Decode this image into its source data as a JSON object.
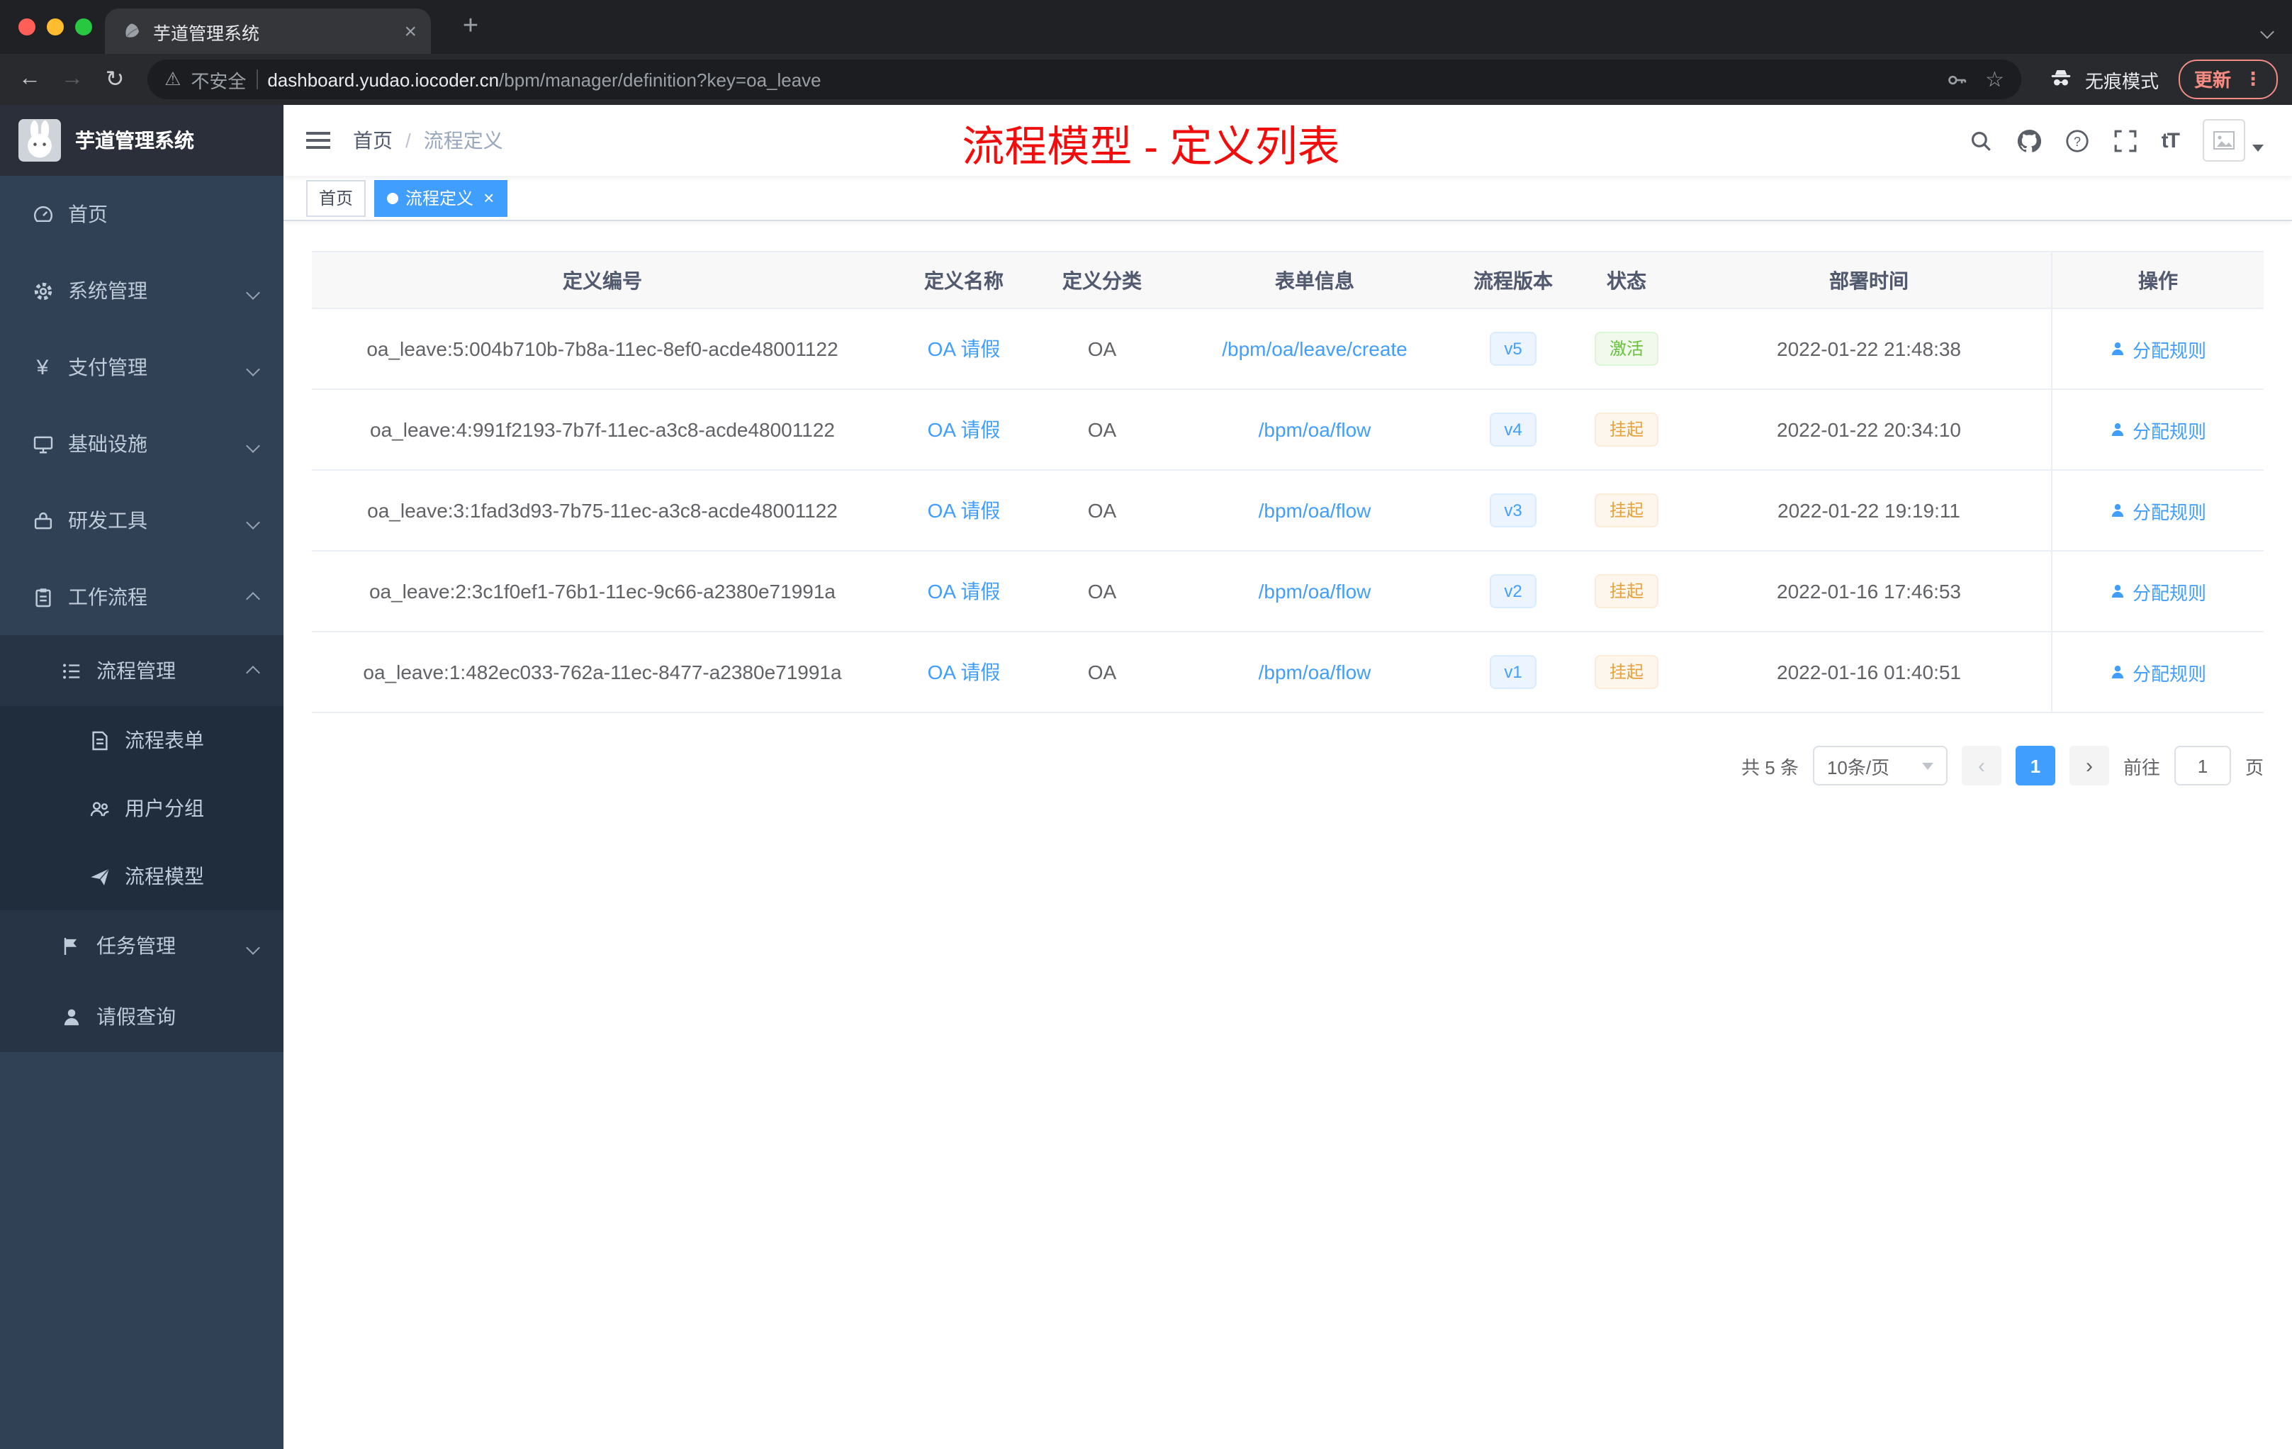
{
  "browser": {
    "tab": {
      "title": "芋道管理系统",
      "close": "×",
      "new_tab": "+"
    },
    "security_label": "不安全",
    "url_host": "dashboard.yudao.iocoder.cn",
    "url_path": "/bpm/manager/definition?key=oa_leave",
    "incognito_label": "无痕模式",
    "update_label": "更新",
    "menu_dots": "⋮"
  },
  "sidebar": {
    "logo_title": "芋道管理系统",
    "items": [
      {
        "label": "首页",
        "icon": "dashboard-icon",
        "level": 1
      },
      {
        "label": "系统管理",
        "icon": "gear-icon",
        "level": 1,
        "chevron": "down"
      },
      {
        "label": "支付管理",
        "icon": "yen-icon",
        "level": 1,
        "chevron": "down"
      },
      {
        "label": "基础设施",
        "icon": "infrastructure-icon",
        "level": 1,
        "chevron": "down"
      },
      {
        "label": "研发工具",
        "icon": "tools-icon",
        "level": 1,
        "chevron": "down"
      },
      {
        "label": "工作流程",
        "icon": "workflow-icon",
        "level": 1,
        "chevron": "up"
      },
      {
        "label": "流程管理",
        "icon": "process-list-icon",
        "level": 2,
        "chevron": "up"
      },
      {
        "label": "流程表单",
        "icon": "form-icon",
        "level": 3
      },
      {
        "label": "用户分组",
        "icon": "user-group-icon",
        "level": 3
      },
      {
        "label": "流程模型",
        "icon": "paper-plane-icon",
        "level": 3
      },
      {
        "label": "任务管理",
        "icon": "task-flag-icon",
        "level": 2,
        "chevron": "down"
      },
      {
        "label": "请假查询",
        "icon": "person-icon",
        "level": 2
      }
    ]
  },
  "header": {
    "breadcrumb_first": "首页",
    "breadcrumb_sep": "/",
    "breadcrumb_last": "流程定义",
    "annotation": "流程模型 - 定义列表",
    "icons": [
      "search-icon",
      "github-icon",
      "help-icon",
      "fullscreen-icon",
      "font-size-icon",
      "avatar"
    ]
  },
  "tags": [
    {
      "label": "首页",
      "active": false
    },
    {
      "label": "流程定义",
      "active": true,
      "close": "×"
    }
  ],
  "table": {
    "columns": [
      "定义编号",
      "定义名称",
      "定义分类",
      "表单信息",
      "流程版本",
      "状态",
      "部署时间",
      "操作"
    ],
    "rows": [
      {
        "id": "oa_leave:5:004b710b-7b8a-11ec-8ef0-acde48001122",
        "name": "OA 请假",
        "category": "OA",
        "form": "/bpm/oa/leave/create",
        "version": "v5",
        "status": "激活",
        "time": "2022-01-22 21:48:38",
        "action": "分配规则"
      },
      {
        "id": "oa_leave:4:991f2193-7b7f-11ec-a3c8-acde48001122",
        "name": "OA 请假",
        "category": "OA",
        "form": "/bpm/oa/flow",
        "version": "v4",
        "status": "挂起",
        "time": "2022-01-22 20:34:10",
        "action": "分配规则"
      },
      {
        "id": "oa_leave:3:1fad3d93-7b75-11ec-a3c8-acde48001122",
        "name": "OA 请假",
        "category": "OA",
        "form": "/bpm/oa/flow",
        "version": "v3",
        "status": "挂起",
        "time": "2022-01-22 19:19:11",
        "action": "分配规则"
      },
      {
        "id": "oa_leave:2:3c1f0ef1-76b1-11ec-9c66-a2380e71991a",
        "name": "OA 请假",
        "category": "OA",
        "form": "/bpm/oa/flow",
        "version": "v2",
        "status": "挂起",
        "time": "2022-01-16 17:46:53",
        "action": "分配规则"
      },
      {
        "id": "oa_leave:1:482ec033-762a-11ec-8477-a2380e71991a",
        "name": "OA 请假",
        "category": "OA",
        "form": "/bpm/oa/flow",
        "version": "v1",
        "status": "挂起",
        "time": "2022-01-16 01:40:51",
        "action": "分配规则"
      }
    ]
  },
  "pagination": {
    "total": "共 5 条",
    "page_size": "10条/页",
    "prev": "‹",
    "page": "1",
    "next": "›",
    "goto_label": "前往",
    "goto_value": "1",
    "unit": "页"
  },
  "colors": {
    "accent": "#409eff",
    "success": "#67c23a",
    "warning": "#e6a23c",
    "annotation_red": "#f20d0d",
    "sidebar_bg": "#304156",
    "update_pill": "#f28b82"
  }
}
